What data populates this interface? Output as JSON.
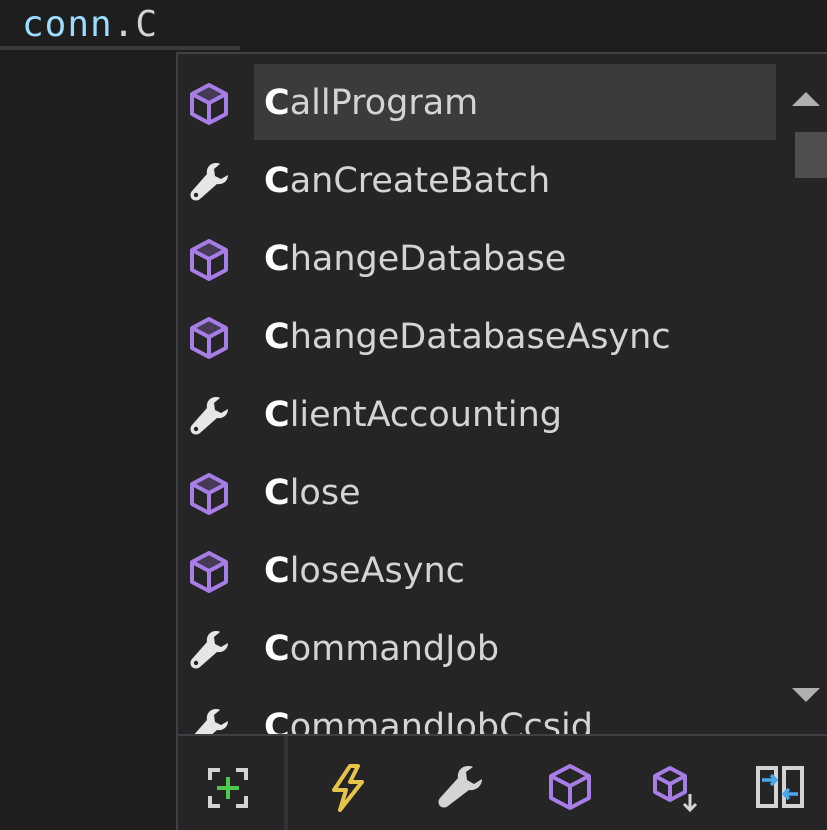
{
  "editor": {
    "identifier": "conn",
    "dot": ".",
    "typed": "C"
  },
  "completion": {
    "selected_index": 0,
    "items": [
      {
        "match": "C",
        "rest": "allProgram",
        "kind": "method",
        "icon": "method-cube-icon"
      },
      {
        "match": "C",
        "rest": "anCreateBatch",
        "kind": "property",
        "icon": "wrench-icon"
      },
      {
        "match": "C",
        "rest": "hangeDatabase",
        "kind": "method",
        "icon": "method-cube-icon"
      },
      {
        "match": "C",
        "rest": "hangeDatabaseAsync",
        "kind": "method",
        "icon": "method-cube-icon"
      },
      {
        "match": "C",
        "rest": "lientAccounting",
        "kind": "property",
        "icon": "wrench-icon"
      },
      {
        "match": "C",
        "rest": "lose",
        "kind": "method",
        "icon": "method-cube-icon"
      },
      {
        "match": "C",
        "rest": "loseAsync",
        "kind": "method",
        "icon": "method-cube-icon"
      },
      {
        "match": "C",
        "rest": "ommandJob",
        "kind": "property",
        "icon": "wrench-icon"
      },
      {
        "match": "C",
        "rest": "ommandJobCcsid",
        "kind": "property",
        "icon": "wrench-icon"
      }
    ]
  },
  "toolbar": {
    "filters": [
      {
        "name": "expand-filter-icon",
        "color": "#4ec94e"
      },
      {
        "name": "event-lightning-icon",
        "color": "#e8c34a"
      },
      {
        "name": "property-wrench-icon",
        "color": "#d4d4d4"
      },
      {
        "name": "method-cube-icon",
        "color": "#a77ee6"
      },
      {
        "name": "extension-method-icon",
        "color": "#a77ee6"
      },
      {
        "name": "interface-swap-icon",
        "color": "#4aa8e8"
      }
    ]
  },
  "colors": {
    "background": "#1e1e1e",
    "popup": "#252526",
    "selection": "#3b3b3b",
    "method_purple": "#a77ee6",
    "text": "#d4d4d4"
  }
}
